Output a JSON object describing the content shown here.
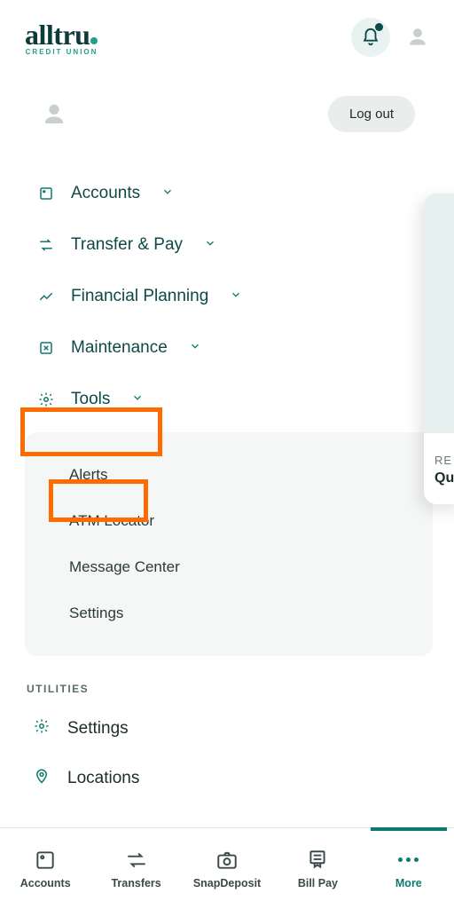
{
  "brand": {
    "name": "alltru",
    "tagline": "CREDIT UNION"
  },
  "header": {
    "logout": "Log out"
  },
  "nav": {
    "items": [
      {
        "label": "Accounts"
      },
      {
        "label": "Transfer & Pay"
      },
      {
        "label": "Financial Planning"
      },
      {
        "label": "Maintenance"
      },
      {
        "label": "Tools"
      }
    ]
  },
  "tools_submenu": {
    "items": [
      {
        "label": "Alerts"
      },
      {
        "label": "ATM Locator"
      },
      {
        "label": "Message Center"
      },
      {
        "label": "Settings"
      }
    ]
  },
  "utilities": {
    "heading": "UTILITIES",
    "items": [
      {
        "label": "Settings"
      },
      {
        "label": "Locations"
      }
    ]
  },
  "peek": {
    "line1": "RE",
    "line2": "Qu"
  },
  "tabbar": {
    "items": [
      {
        "label": "Accounts"
      },
      {
        "label": "Transfers"
      },
      {
        "label": "SnapDeposit"
      },
      {
        "label": "Bill Pay"
      },
      {
        "label": "More"
      }
    ],
    "active_index": 4
  },
  "highlights": [
    "tools-nav",
    "alerts-subitem"
  ]
}
